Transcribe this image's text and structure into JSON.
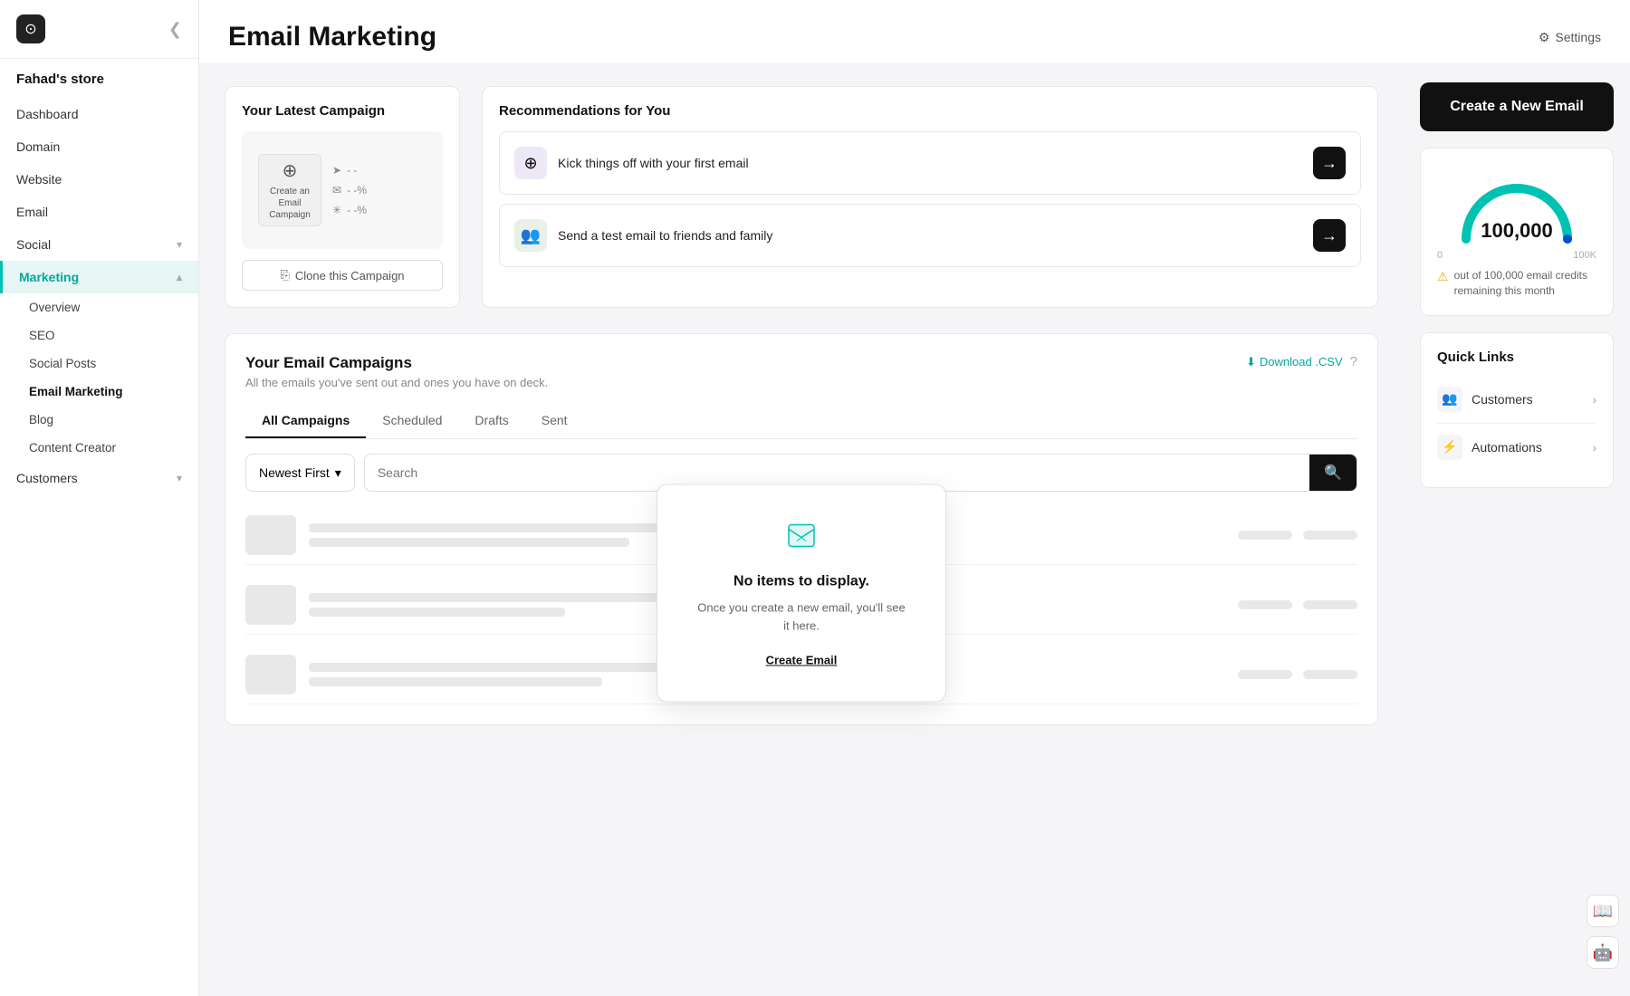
{
  "app": {
    "logo_symbol": "⊙",
    "store_name": "Fahad's store",
    "collapse_icon": "❮"
  },
  "sidebar": {
    "nav_items": [
      {
        "label": "Dashboard",
        "active": false,
        "has_children": false
      },
      {
        "label": "Domain",
        "active": false,
        "has_children": false
      },
      {
        "label": "Website",
        "active": false,
        "has_children": false
      },
      {
        "label": "Email",
        "active": false,
        "has_children": false
      },
      {
        "label": "Social",
        "active": false,
        "has_children": true
      },
      {
        "label": "Marketing",
        "active": true,
        "has_children": true
      }
    ],
    "marketing_sub_items": [
      {
        "label": "Overview",
        "active": false
      },
      {
        "label": "SEO",
        "active": false
      },
      {
        "label": "Social Posts",
        "active": false
      },
      {
        "label": "Email Marketing",
        "active": true
      },
      {
        "label": "Blog",
        "active": false
      },
      {
        "label": "Content Creator",
        "active": false
      }
    ],
    "customers_item": {
      "label": "Customers",
      "has_children": true
    }
  },
  "header": {
    "title": "Email Marketing",
    "settings_label": "Settings"
  },
  "latest_campaign": {
    "section_title": "Your Latest Campaign",
    "inner_label_line1": "Create an",
    "inner_label_line2": "Email",
    "inner_label_line3": "Campaign",
    "clone_btn_label": "Clone this Campaign"
  },
  "recommendations": {
    "section_title": "Recommendations for You",
    "items": [
      {
        "text": "Kick things off with your first email",
        "icon": "➕"
      },
      {
        "text": "Send a test email to friends and family",
        "icon": "👥"
      }
    ]
  },
  "email_campaigns": {
    "section_title": "Your Email Campaigns",
    "section_subtitle": "All the emails you've sent out and ones you have on deck.",
    "download_label": "Download .CSV",
    "tabs": [
      {
        "label": "All Campaigns",
        "active": true
      },
      {
        "label": "Scheduled",
        "active": false
      },
      {
        "label": "Drafts",
        "active": false
      },
      {
        "label": "Sent",
        "active": false
      }
    ],
    "sort_label": "Newest First",
    "search_placeholder": "Search",
    "empty_modal": {
      "title": "No items to display.",
      "description": "Once you create a new email, you'll see it here.",
      "create_link_label": "Create Email"
    }
  },
  "right_panel": {
    "create_btn_label": "Create a New Email",
    "credits_value": "100,000",
    "credits_min": "0",
    "credits_max": "100K",
    "credits_warning": "out of 100,000 email credits remaining this month",
    "quick_links": {
      "title": "Quick Links",
      "items": [
        {
          "label": "Customers",
          "icon": "👥"
        },
        {
          "label": "Automations",
          "icon": "⚡"
        }
      ]
    }
  }
}
